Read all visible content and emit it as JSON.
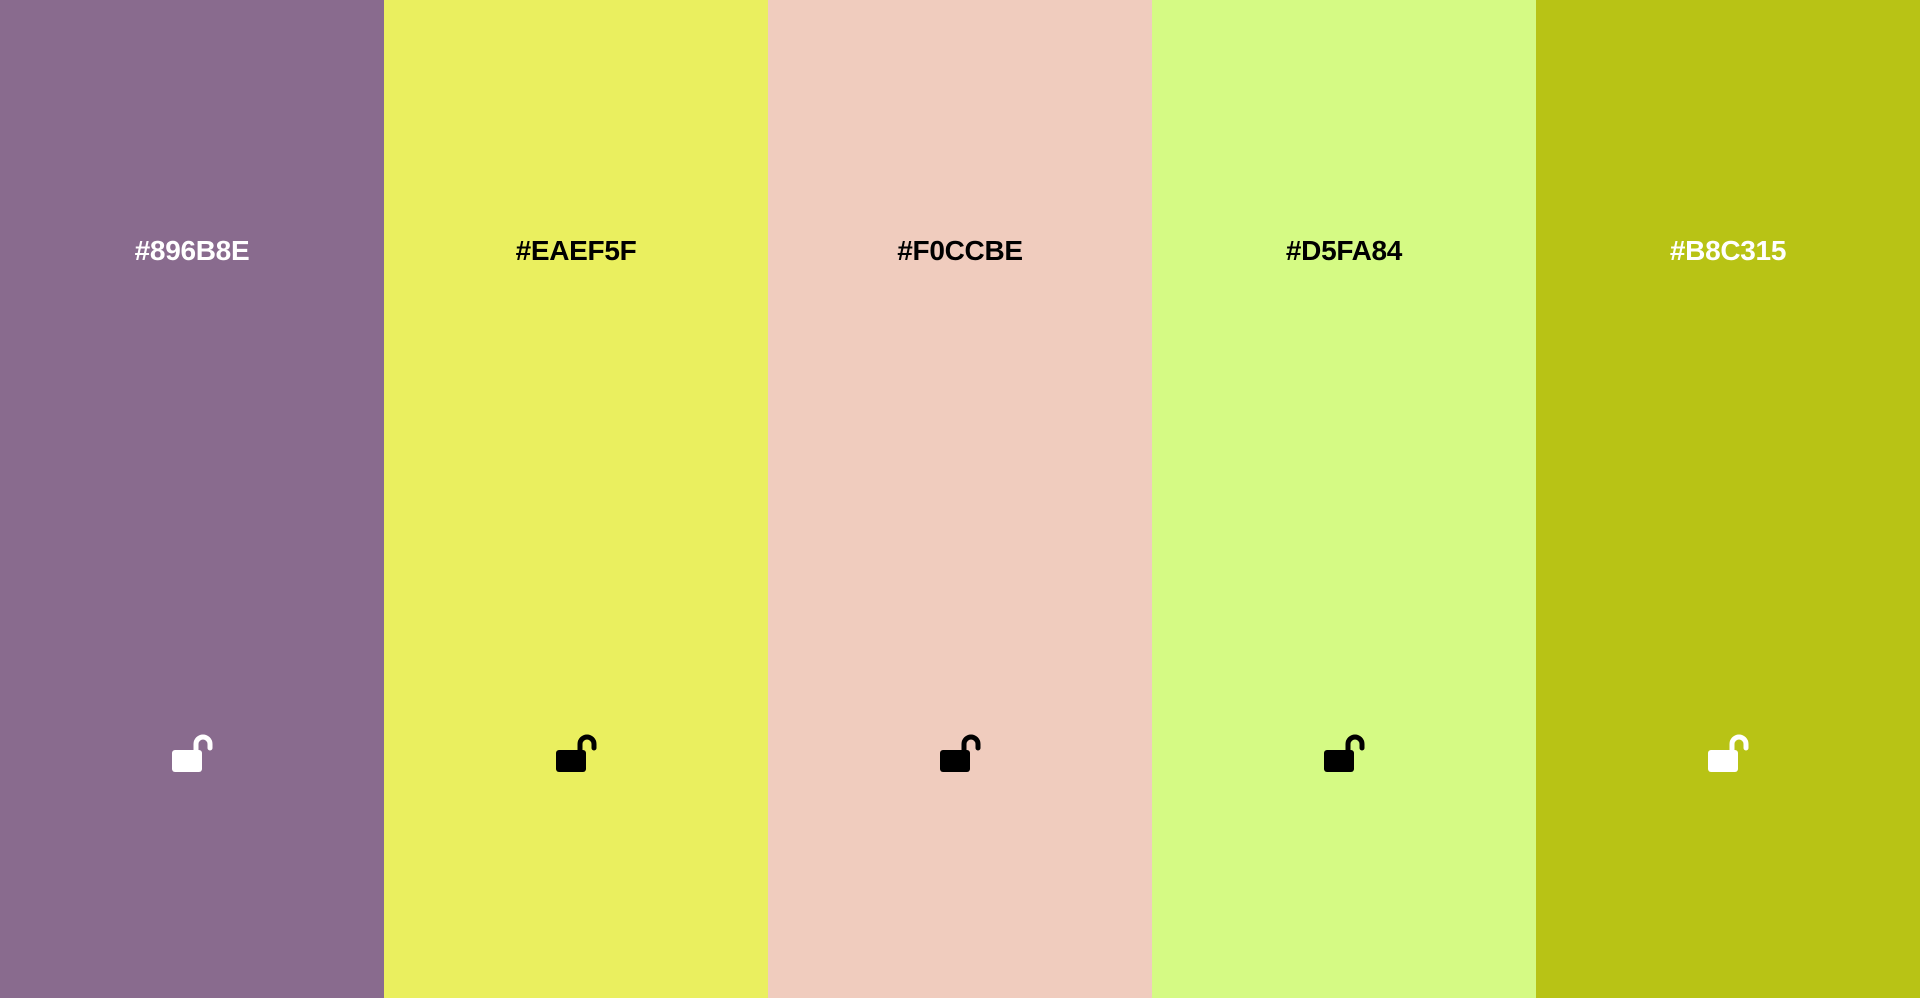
{
  "palette": {
    "swatches": [
      {
        "hex": "#896B8E",
        "bg": "#896B8E",
        "fg": "#FFFFFF",
        "icon": "unlocked-padlock-icon"
      },
      {
        "hex": "#EAEF5F",
        "bg": "#EAEF5F",
        "fg": "#000000",
        "icon": "unlocked-padlock-icon"
      },
      {
        "hex": "#F0CCBE",
        "bg": "#F0CCBE",
        "fg": "#000000",
        "icon": "unlocked-padlock-icon"
      },
      {
        "hex": "#D5FA84",
        "bg": "#D5FA84",
        "fg": "#000000",
        "icon": "unlocked-padlock-icon"
      },
      {
        "hex": "#B8C315",
        "bg": "#B8C315",
        "fg": "#FFFFFF",
        "icon": "unlocked-padlock-icon"
      }
    ]
  }
}
